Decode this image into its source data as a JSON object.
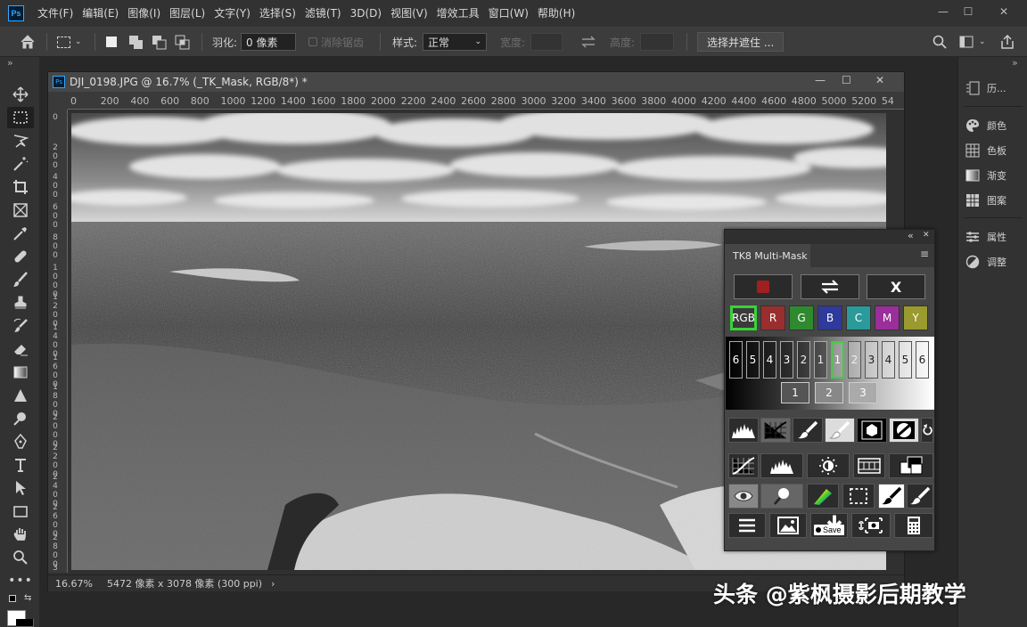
{
  "app": {
    "logo": "Ps"
  },
  "menu": [
    "文件(F)",
    "编辑(E)",
    "图像(I)",
    "图层(L)",
    "文字(Y)",
    "选择(S)",
    "滤镜(T)",
    "3D(D)",
    "视图(V)",
    "增效工具",
    "窗口(W)",
    "帮助(H)"
  ],
  "window_controls": {
    "minimize": "—",
    "maximize": "☐",
    "close": "✕"
  },
  "options": {
    "feather_label": "羽化:",
    "feather_value": "0 像素",
    "antialias_label": "消除锯齿",
    "style_label": "样式:",
    "style_value": "正常",
    "width_label": "宽度:",
    "height_label": "高度:",
    "select_mask_button": "选择并遮住 ..."
  },
  "right_panel": {
    "collapse": "»",
    "items": [
      "历...",
      "颜色",
      "色板",
      "渐变",
      "图案",
      "属性",
      "调整"
    ]
  },
  "toolbar": {
    "collapse": "»"
  },
  "document": {
    "title": "DJI_0198.JPG @ 16.7% (_TK_Mask, RGB/8*) *",
    "ruler_h": [
      "0",
      "200",
      "400",
      "600",
      "800",
      "1000",
      "1200",
      "1400",
      "1600",
      "1800",
      "2000",
      "2200",
      "2400",
      "2600",
      "2800",
      "3000",
      "3200",
      "3400",
      "3600",
      "3800",
      "4000",
      "4200",
      "4400",
      "4600",
      "4800",
      "5000",
      "5200",
      "54"
    ],
    "ruler_v": [
      "0",
      "200",
      "400",
      "600",
      "800",
      "1000",
      "1200",
      "1400",
      "1600",
      "1800",
      "2000",
      "2200",
      "2400",
      "2600",
      "2800",
      "3000"
    ],
    "zoom": "16.67%",
    "dimensions": "5472 像素 x 3078 像素 (300 ppi)",
    "status_arrow": "›"
  },
  "tk8": {
    "collapse": "«",
    "close": "✕",
    "tab": "TK8 Multi-Mask",
    "menu_icon": "≡",
    "x_button": "X",
    "channels": [
      {
        "label": "RGB",
        "color": "#3a3a3a",
        "selected": true
      },
      {
        "label": "R",
        "color": "#9a2e2e"
      },
      {
        "label": "G",
        "color": "#2f8a2f"
      },
      {
        "label": "B",
        "color": "#2f3a9a"
      },
      {
        "label": "C",
        "color": "#2a9a9a"
      },
      {
        "label": "M",
        "color": "#9a2e9a"
      },
      {
        "label": "Y",
        "color": "#9a9a2e"
      }
    ],
    "zones": [
      "6",
      "5",
      "4",
      "3",
      "2",
      "1",
      "1",
      "2",
      "3",
      "4",
      "5",
      "6"
    ],
    "zones_row2": [
      "1",
      "2",
      "3"
    ],
    "save_label": "Save",
    "accent_green": "#39d239"
  },
  "watermark": "头条 @紫枫摄影后期教学"
}
